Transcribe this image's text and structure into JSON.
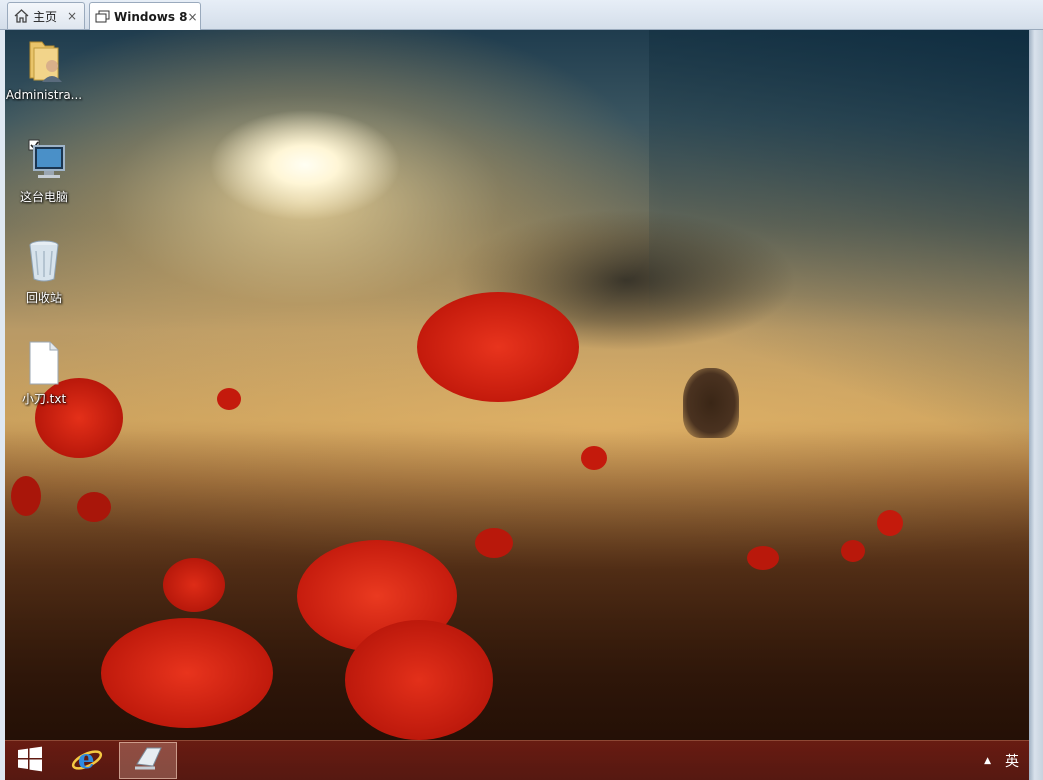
{
  "tabs": [
    {
      "label": "主页",
      "icon": "home-icon",
      "close": "×"
    },
    {
      "label": "Windows 8",
      "icon": "vm-icon",
      "close": "×"
    }
  ],
  "desktop": {
    "icons": [
      {
        "label": "Administra...",
        "icon": "user-folder-icon"
      },
      {
        "label": "这台电脑",
        "icon": "computer-icon"
      },
      {
        "label": "回收站",
        "icon": "recycle-bin-icon"
      },
      {
        "label": "小刀.txt",
        "icon": "text-file-icon"
      }
    ]
  },
  "taskbar": {
    "start_icon": "windows-logo-icon",
    "pinned": [
      "internet-explorer-icon",
      "app-window-icon"
    ],
    "tray": {
      "arrow": "▲",
      "ime": "英"
    }
  },
  "colors": {
    "taskbar": "#6e1e14",
    "poppy_red": "#d41c0e"
  }
}
